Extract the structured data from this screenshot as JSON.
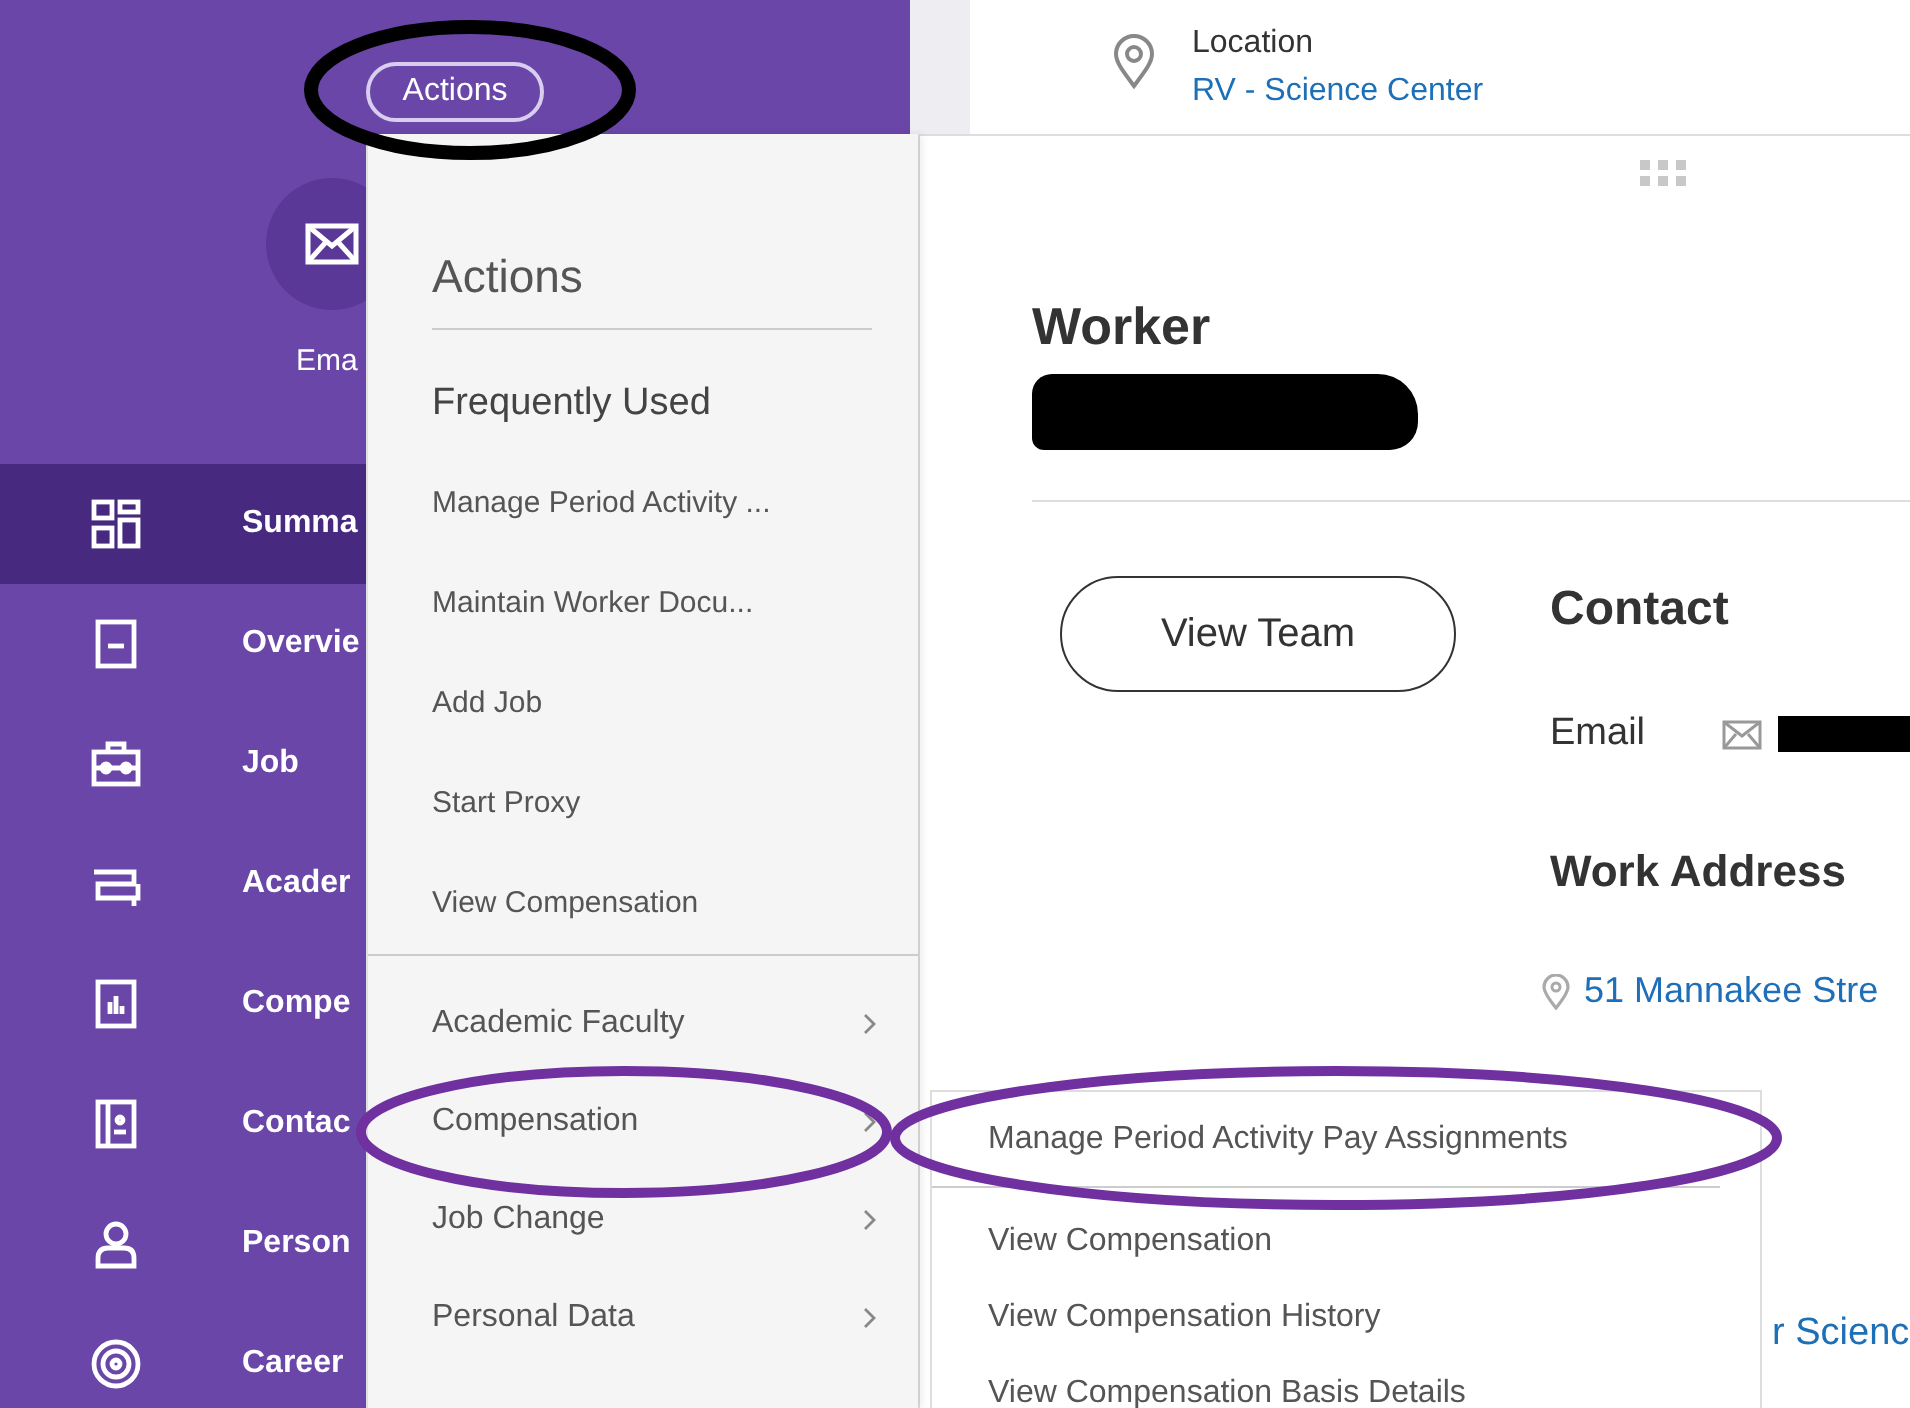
{
  "header": {
    "actions_button": "Actions"
  },
  "profile_action": {
    "label": "Ema"
  },
  "sidebar": {
    "items": [
      {
        "label": "Summa",
        "selected": true
      },
      {
        "label": "Overvie",
        "selected": false
      },
      {
        "label": "Job",
        "selected": false
      },
      {
        "label": "Acader",
        "selected": false
      },
      {
        "label": "Compe",
        "selected": false
      },
      {
        "label": "Contac",
        "selected": false
      },
      {
        "label": "Person",
        "selected": false
      },
      {
        "label": "Career",
        "selected": false
      }
    ]
  },
  "actions_menu": {
    "title": "Actions",
    "section": "Frequently Used",
    "frequent": [
      "Manage Period Activity ...",
      "Maintain Worker Docu...",
      "Add Job",
      "Start Proxy",
      "View Compensation"
    ],
    "categories": [
      "Academic Faculty",
      "Compensation",
      "Job Change",
      "Personal Data"
    ]
  },
  "submenu": {
    "items": [
      "Manage Period Activity Pay Assignments",
      "View Compensation",
      "View Compensation History",
      "View Compensation Basis Details"
    ]
  },
  "location": {
    "label": "Location",
    "value": "RV - Science Center"
  },
  "worker": {
    "title": "Worker"
  },
  "view_team": "View Team",
  "contact": {
    "title": "Contact",
    "email_label": "Email"
  },
  "work_address": {
    "title": "Work Address",
    "address": "51 Mannakee Stre",
    "second_link": "r Scienc"
  },
  "annotations": [
    {
      "color": "#000000"
    },
    {
      "color": "#7030a0"
    },
    {
      "color": "#7030a0"
    }
  ]
}
